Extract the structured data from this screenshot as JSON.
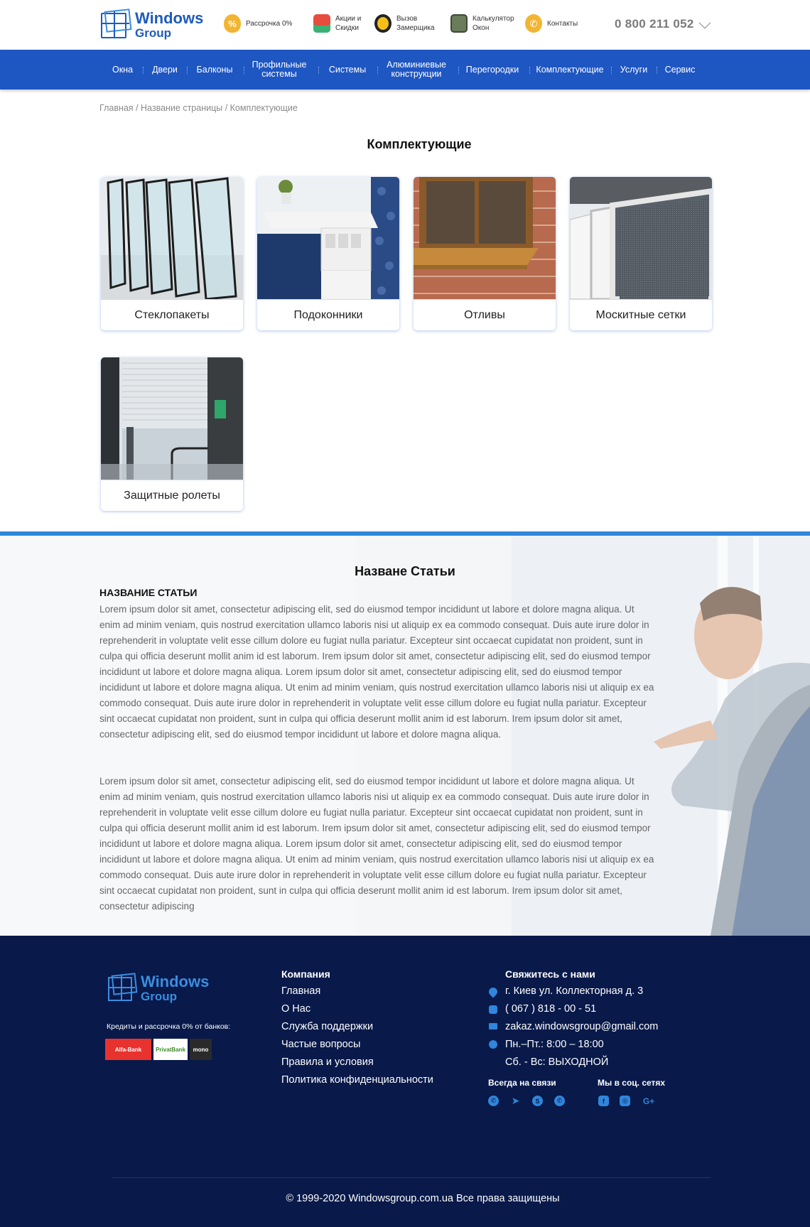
{
  "header": {
    "logo": {
      "line1": "Windows",
      "line2": "Group"
    },
    "items": [
      {
        "icon": "piggy-bank-icon",
        "label": "Рассрочка 0%"
      },
      {
        "icon": "gift-icon",
        "label1": "Акции и",
        "label2": "Скидки"
      },
      {
        "icon": "tape-measure-icon",
        "label1": "Вызов",
        "label2": "Замерщика"
      },
      {
        "icon": "calculator-icon",
        "label1": "Калькулятор",
        "label2": "Окон"
      },
      {
        "icon": "phone-icon",
        "label": "Контакты"
      }
    ],
    "phone": "0 800 211 052"
  },
  "nav": [
    {
      "label": "Окна"
    },
    {
      "label": "Двери"
    },
    {
      "label": "Балконы"
    },
    {
      "label1": "Профильные",
      "label2": "системы"
    },
    {
      "label": "Системы"
    },
    {
      "label1": "Алюминиевые",
      "label2": "конструкции"
    },
    {
      "label": "Перегородки"
    },
    {
      "label": "Комплектующие"
    },
    {
      "label": "Услуги"
    },
    {
      "label": "Сервис"
    }
  ],
  "breadcrumb": "Главная / Название страницы / Комплектующие",
  "page_title": "Комплектующие",
  "cards": [
    {
      "label": "Стеклопакеты"
    },
    {
      "label": "Подоконники"
    },
    {
      "label": "Отливы"
    },
    {
      "label": "Москитные сетки"
    },
    {
      "label": "Защитные ролеты"
    }
  ],
  "article": {
    "title": "Назване Статьи",
    "subtitle": "НАЗВАНИЕ СТАТЬИ",
    "p1": "Lorem ipsum dolor sit amet, consectetur adipiscing elit, sed do eiusmod tempor incididunt ut labore et dolore magna aliqua. Ut enim ad minim veniam, quis nostrud exercitation ullamco laboris nisi ut aliquip ex ea commodo consequat. Duis aute irure dolor in reprehenderit in voluptate velit esse cillum dolore eu fugiat nulla pariatur. Excepteur sint occaecat cupidatat non proident, sunt in culpa qui officia deserunt mollit anim id est laborum. Irem ipsum dolor sit amet, consectetur adipiscing elit, sed do eiusmod tempor incididunt ut labore et dolore magna aliqua. Lorem ipsum dolor sit amet, consectetur adipiscing elit, sed do eiusmod tempor incididunt ut labore et dolore magna aliqua. Ut enim ad minim veniam, quis nostrud exercitation ullamco laboris nisi ut aliquip ex ea commodo consequat. Duis aute irure dolor in reprehenderit in voluptate velit esse cillum dolore eu fugiat nulla pariatur. Excepteur sint occaecat cupidatat non proident, sunt in culpa qui officia deserunt mollit anim id est laborum. Irem ipsum dolor sit amet, consectetur adipiscing elit, sed do eiusmod tempor incididunt ut labore et dolore magna aliqua.",
    "p2": "Lorem ipsum dolor sit amet, consectetur adipiscing elit, sed do eiusmod tempor incididunt ut labore et dolore magna aliqua. Ut enim ad minim veniam, quis nostrud exercitation ullamco laboris nisi ut aliquip ex ea commodo consequat. Duis aute irure dolor in reprehenderit in voluptate velit esse cillum dolore eu fugiat nulla pariatur. Excepteur sint occaecat cupidatat non proident, sunt in culpa qui officia deserunt mollit anim id est laborum. Irem ipsum dolor sit amet, consectetur adipiscing elit, sed do eiusmod tempor incididunt ut labore et dolore magna aliqua. Lorem ipsum dolor sit amet, consectetur adipiscing elit, sed do eiusmod tempor incididunt ut labore et dolore magna aliqua. Ut enim ad minim veniam, quis nostrud exercitation ullamco laboris nisi ut aliquip ex ea commodo consequat. Duis aute irure dolor in reprehenderit in voluptate velit esse cillum dolore eu fugiat nulla pariatur. Excepteur sint occaecat cupidatat non proident, sunt in culpa qui officia deserunt mollit anim id est laborum. Irem ipsum dolor sit amet, consectetur adipiscing"
  },
  "footer": {
    "logo": {
      "line1": "Windows",
      "line2": "Group"
    },
    "credit": "Кредиты и рассрочка  0% от банков:",
    "banks": [
      "Alfa-Bank",
      "PrivatBank",
      "mono"
    ],
    "company_title": "Компания",
    "company_links": [
      "Главная",
      "О Нас",
      "Служба поддержки",
      "Частые вопросы",
      "Правила и условия",
      "Политика конфиденциальности"
    ],
    "contact_title": "Свяжитесь с нами",
    "address": "г. Киев  ул. Коллекторная д. 3",
    "phone": "( 067 ) 818 - 00 - 51",
    "email": "zakaz.windowsgroup@gmail.com",
    "hours1": "Пн.–Пт.: 8:00 – 18:00",
    "hours2": "Сб. - Вс: ВЫХОДНОЙ",
    "messengers_title": "Всегда на связи",
    "social_title": "Мы в соц. сетях",
    "messengers": [
      "viber-icon",
      "telegram-icon",
      "skype-icon",
      "whatsapp-icon"
    ],
    "social": [
      "facebook-icon",
      "instagram-icon",
      "google-plus-icon"
    ],
    "copyright": "© 1999-2020 Windowsgroup.com.ua Все права защищены"
  },
  "colors": {
    "brand": "#1e56c2",
    "accent": "#2f86dc",
    "footer": "#08194a"
  }
}
